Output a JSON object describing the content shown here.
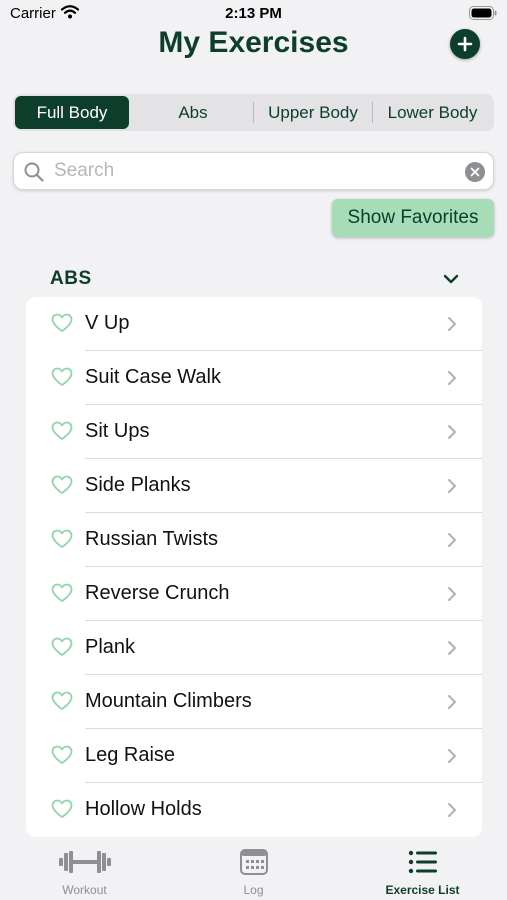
{
  "status_bar": {
    "carrier": "Carrier",
    "time": "2:13 PM"
  },
  "header": {
    "title": "My Exercises",
    "add_icon": "plus-circle-icon"
  },
  "segments": [
    {
      "label": "Full Body",
      "active": true
    },
    {
      "label": "Abs",
      "active": false
    },
    {
      "label": "Upper Body",
      "active": false
    },
    {
      "label": "Lower Body",
      "active": false
    }
  ],
  "search": {
    "placeholder": "Search",
    "value": ""
  },
  "favorites_button": {
    "label": "Show Favorites"
  },
  "section": {
    "title": "ABS",
    "items": [
      {
        "label": "V Up"
      },
      {
        "label": "Suit Case Walk"
      },
      {
        "label": "Sit Ups"
      },
      {
        "label": "Side Planks"
      },
      {
        "label": "Russian Twists"
      },
      {
        "label": "Reverse Crunch"
      },
      {
        "label": "Plank"
      },
      {
        "label": "Mountain Climbers"
      },
      {
        "label": "Leg Raise"
      },
      {
        "label": "Hollow Holds"
      }
    ]
  },
  "tab_bar": {
    "tabs": [
      {
        "label": "Workout",
        "icon": "dumbbell-icon",
        "active": false
      },
      {
        "label": "Log",
        "icon": "calendar-icon",
        "active": false
      },
      {
        "label": "Exercise List",
        "icon": "list-icon",
        "active": true
      }
    ]
  },
  "colors": {
    "primary": "#0d3d2b",
    "favorites_bg": "#a6dcb6",
    "heart": "#8fd6a8",
    "background": "#f2f2f5"
  }
}
